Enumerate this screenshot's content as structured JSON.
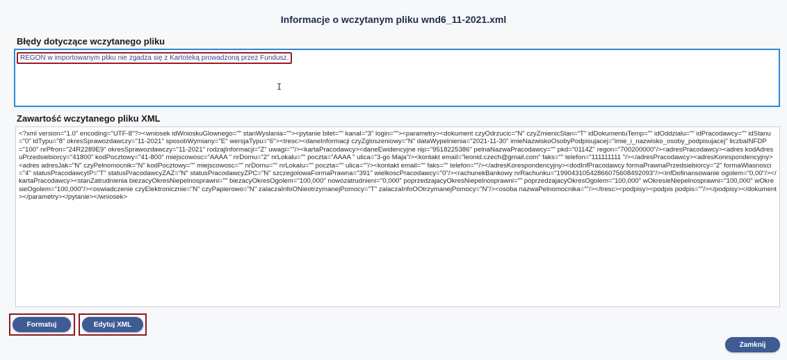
{
  "dialog": {
    "title": "Informacje o wczytanym pliku wnd6_11-2021.xml"
  },
  "errors": {
    "label": "Błędy dotyczące wczytanego pliku",
    "message": "REGON w importowanym pliku nie zgadza się z Kartoteką prowadzoną przez Fundusz."
  },
  "xml": {
    "label": "Zawartość wczytanego pliku XML",
    "content": "<?xml version=\"1.0\" encoding=\"UTF-8\"?><wniosek idWnioskuGlownego=\"\" stanWyslania=\"\"><pytanie bilet=\"\" kanal=\"3\" login=\"\"><parametry><dokument czyOdrzucic=\"N\" czyZmienicStan=\"T\" idDokumentuTemp=\"\" idOddzialu=\"\" idPracodawcy=\"\" idStanu=\"0\" idTypu=\"8\" okresSprawozdawczy=\"11-2021\" sposobWymiany=\"E\" wersjaTypu=\"6\"><tresc><daneInformacji czyZgloszeniowy=\"N\" dataWypelnienia=\"2021-11-30\" imieNazwiskoOsobyPodpisujacej=\"imie_i_nazwisko_osoby_podpisujacej\" liczbaINFDP=\"100\" nrPfron=\"24R2289E9\" okresSprawozdawczy=\"11-2021\" rodzajInformacji=\"Z\" uwagi=\"\"/><kartaPracodawcy><daneEwidencyjne nip=\"9518225386\" pelnaNazwaPracodawcy=\"\" pkd=\"0114Z\" regon=\"700200000\"/><adresPracodawcy><adres kodAdresuPrzedsiebiorcy=\"41800\" kodPocztowy=\"41-800\" miejscowosc=\"AAAA \" nrDomu=\"2\" nrLokalu=\"\" poczta=\"AAAA \" ulica=\"3-go Maja\"/><kontakt email=\"leonid.czech@gmail.com\" faks=\"\" telefon=\"111111111 \"/></adresPracodawcy><adresKorespondencyjny><adres adresJak=\"N\" czyPelnomocnik=\"N\" kodPocztowy=\"\" miejscowosc=\"\" nrDomu=\"\" nrLokalu=\"\" poczta=\"\" ulica=\"\"/><kontakt email=\"\" faks=\"\" telefon=\"\"/></adresKorespondencyjny><dodInfPracodawcy formaPrawnaPrzedsiebiorcy=\"2\" formaWlasnosci=\"4\" statusPracodawcyIP=\"T\" statusPracodawcyZAZ=\"N\" statusPracodawcyZPC=\"N\" szczegolowaFormaPrawna=\"391\" wielkoscPracodawcy=\"0\"/><rachunekBankowy nrRachunku=\"19904310542866075608492093\"/><infDofinansowanie ogolem=\"0,00\"/></kartaPracodawcy><stanZatrudnienia biezacyOkresNiepelnosprawni=\"\" biezacyOkresOgolem=\"100,000\" nowozatrudnieni=\"0,000\" poprzedzajacyOkresNiepelnosprawni=\"\" poprzedzajacyOkresOgolem=\"100,000\" wOkresieNiepelnosprawni=\"100,000\" wOkresieOgolem=\"100,000\"/><oswiadczenie czyElektronicznie=\"N\" czyPapierowo=\"N\" zalaczaInfoONieotrzymanejPomocy=\"T\" zalaczaInfoOOtrzymanejPomocy=\"N\"/><osoba nazwaPelnomocnika=\"\"/></tresc><podpisy><podpis podpis=\"\"/></podpisy></dokument></parametry></pytanie></wniosek>"
  },
  "buttons": {
    "format": "Formatuj",
    "edit_xml": "Edytuj XML",
    "close": "Zamknij"
  },
  "colors": {
    "accent_border": "#2a8ad6",
    "button": "#3f5b94",
    "highlight_frame": "#8a1b1f"
  }
}
